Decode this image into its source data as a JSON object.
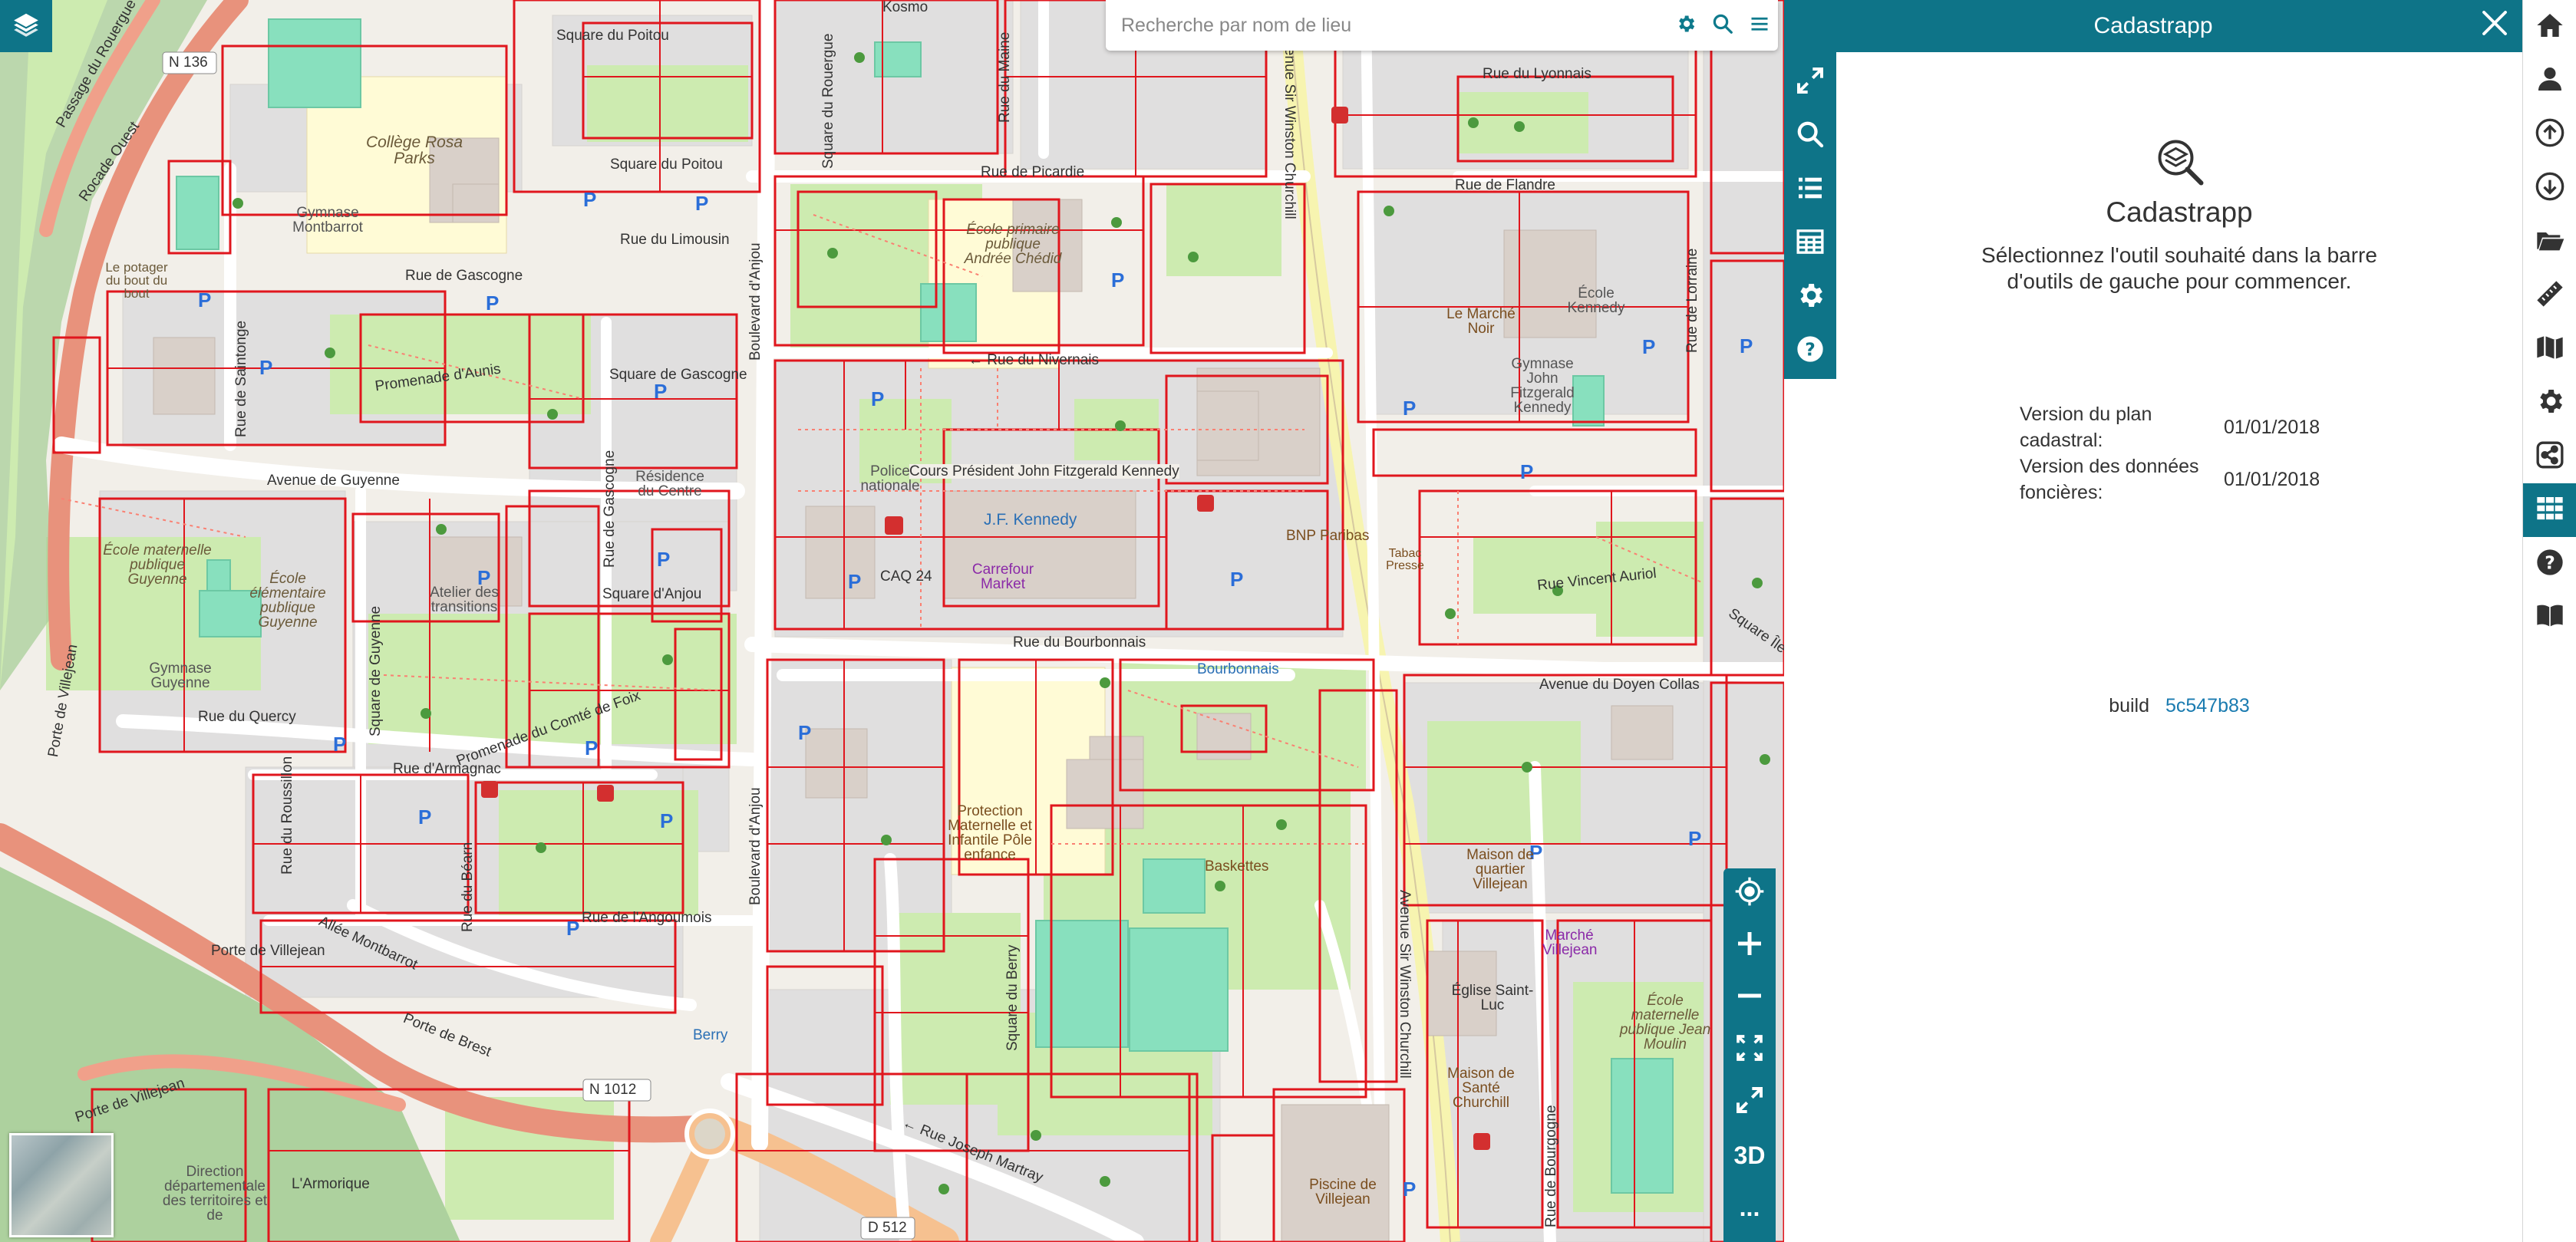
{
  "search": {
    "placeholder": "Recherche par nom de lieu",
    "value": ""
  },
  "panel": {
    "header_title": "Cadastrapp",
    "title": "Cadastrapp",
    "instructions": "Sélectionnez l'outil souhaité dans la barre d'outils de gauche pour commencer.",
    "version_rows": [
      {
        "label": "Version du plan cadastral:",
        "value": "01/01/2018"
      },
      {
        "label": "Version des données foncières:",
        "value": "01/01/2018"
      }
    ],
    "build_label": "build",
    "build_hash": "5c547b83"
  },
  "map_controls": {
    "three_d_label": "3D",
    "more_label": "..."
  },
  "map": {
    "streets": {
      "square_poitou_top": "Square du Poitou",
      "square_poitou": "Square du Poitou",
      "rue_picardie": "Rue de Picardie",
      "rue_lyonnais": "Rue du Lyonnais",
      "rue_flandre": "Rue de Flandre",
      "rue_limousin": "Rue du Limousin",
      "rue_gascogne": "Rue de Gascogne",
      "square_gascogne": "Square de Gascogne",
      "rue_nivernais": "← Rue du Nivernais",
      "promenade_aunis": "Promenade d'Aunis",
      "avenue_guyenne": "Avenue de Guyenne",
      "cours_kennedy": "Cours Président John Fitzgerald Kennedy",
      "square_anjou": "Square d'Anjou",
      "rue_vincent_auriol": "Rue Vincent Auriol",
      "rue_bourbonnais": "Rue du Bourbonnais",
      "avenue_doyen_collas": "Avenue du Doyen Collas",
      "rue_quercy": "Rue du Quercy",
      "promenade_comte_foix": "Promenade du Comté de Foix",
      "rue_armagnac": "Rue d'Armagnac",
      "rue_angoumois": "Rue de l'Angoumois",
      "allee_montbarrot": "Allée Montbarrot",
      "porte_villejean": "Porte de Villejean",
      "porte_brest": "Porte de Brest",
      "rue_joseph_martray": "← Rue Joseph Martray",
      "n136": "N 136",
      "n1012": "N 1012",
      "d512": "D 512",
      "rue_maine": "Rue du Maine",
      "square_rouergue": "Passage du Rouergue",
      "rocade_ouest": "Rocade Ouest",
      "boulevard_anjou": "Boulevard d'Anjou",
      "boulevard_anjou2": "Boulevard d'Anjou",
      "avenue_churchill": "Avenue Sir Winston Churchill",
      "rue_lorraine": "Rue de Lorraine",
      "rue_bourgogne": "Rue de Bourgogne",
      "square_saintonge": "Rue de Saintonge",
      "square_guyenne": "Square de Guyenne",
      "rue_gascogne_v": "Rue de Gascogne",
      "rue_roussillon": "Rue du Roussillon",
      "rue_bearn": "Rue du Béarn",
      "square_berry": "Square du Berry",
      "square_rouergue2": "Square du Rouergue",
      "porte_villejean_v": "Porte de Villejean",
      "square_ile": "Square Île-de-"
    },
    "places": {
      "college": "Collège Rosa Parks",
      "gymnase_montbarrot": "Gymnase Montbarrot",
      "ecole_primaire": "École primaire publique Andrée Chédid",
      "le_marche_noir": "Le Marché Noir",
      "ecole_kennedy": "École Kennedy",
      "gymnase_kennedy": "Gymnase John Fitzgerald Kennedy",
      "police": "Police nationale",
      "jf_kennedy": "J.F. Kennedy",
      "carrefour": "Carrefour Market",
      "residence": "Résidence du Centre",
      "ecole_maternelle_guyenne": "École maternelle publique Guyenne",
      "ecole_elementaire_guyenne": "École élémentaire publique Guyenne",
      "atelier": "Atelier des transitions",
      "gymnase_guyenne": "Gymnase Guyenne",
      "protection": "Protection Maternelle et Infantile Pôle enfance",
      "baskettes": "Baskettes",
      "bourbonnais": "Bourbonnais",
      "maison_quartier": "Maison de quartier Villejean",
      "marche_villejean": "Marché Villejean",
      "eglise": "Église Saint-Luc",
      "ecole_jean_moulin": "École maternelle publique Jean Moulin",
      "maison_sante": "Maison de Santé Churchill",
      "piscine": "Piscine de Villejean",
      "direction": "Direction départementale des territoires et de",
      "armorique": "L'Armorique",
      "le_potager": "Le potager du bout du bout",
      "berry": "Berry",
      "bnp": "BNP Paribas",
      "tabac": "Tabac Presse",
      "caq": "CAQ 24",
      "kosmo": "Kosmo"
    }
  },
  "colors": {
    "accent": "#0e7488",
    "parcel_line": "#e0161d",
    "link": "#1a7bb0",
    "road_primary": "#f0a08a",
    "road_trunk": "#e8927c",
    "park": "#cdebb0",
    "pitch": "#88e0be",
    "school_area": "#fffbd6"
  },
  "icons": {
    "layers": "layers-icon",
    "search_settings": "gear-icon",
    "search": "search-icon",
    "menu": "hamburger-icon",
    "close": "close-icon",
    "panel_logo": "cadastre-search-icon",
    "toolbar": [
      "expand-icon",
      "zoom-search-icon",
      "list-icon",
      "table-icon",
      "gear-icon",
      "help-icon"
    ],
    "sidebar": [
      "home-icon",
      "user-icon",
      "upload-icon",
      "download-icon",
      "folder-icon",
      "ruler-icon",
      "map-icon",
      "gear-icon",
      "share-icon",
      "grid-icon",
      "help-icon",
      "book-icon"
    ],
    "map_controls": [
      "locate-icon",
      "zoom-in-icon",
      "zoom-out-icon",
      "full-extent-icon",
      "fullscreen-icon",
      "3d-toggle",
      "more-icon"
    ]
  }
}
